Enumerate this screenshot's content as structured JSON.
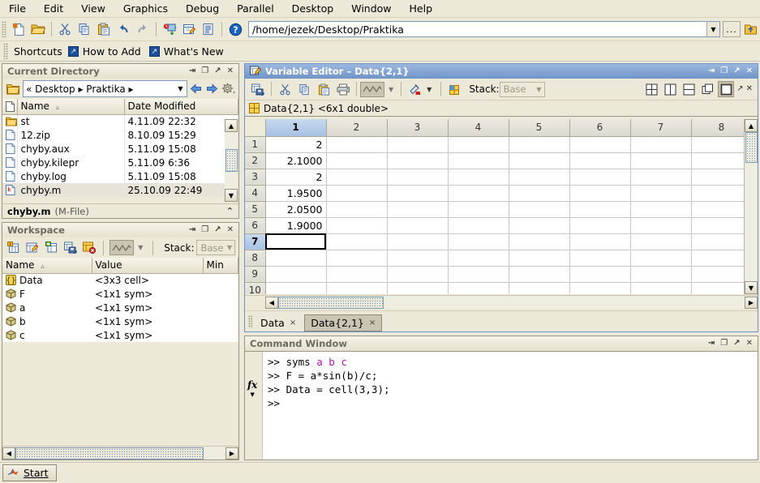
{
  "menubar": {
    "items": [
      {
        "label": "File"
      },
      {
        "label": "Edit"
      },
      {
        "label": "View"
      },
      {
        "label": "Graphics"
      },
      {
        "label": "Debug"
      },
      {
        "label": "Parallel"
      },
      {
        "label": "Desktop"
      },
      {
        "label": "Window"
      },
      {
        "label": "Help"
      }
    ]
  },
  "toolbar": {
    "buttons": [
      {
        "name": "new-file-icon"
      },
      {
        "name": "open-folder-icon"
      },
      {
        "name": "cut-icon"
      },
      {
        "name": "copy-icon"
      },
      {
        "name": "paste-icon"
      },
      {
        "name": "undo-icon"
      },
      {
        "name": "redo-icon"
      },
      {
        "name": "simulink-icon"
      },
      {
        "name": "guide-icon"
      },
      {
        "name": "profiler-icon"
      },
      {
        "name": "help-icon"
      }
    ],
    "path_value": "/home/jezek/Desktop/Praktika",
    "browse_label": "...",
    "up_dir_name": "up-one-level-icon"
  },
  "shortcuts": {
    "label": "Shortcuts",
    "items": [
      {
        "label": "How to Add"
      },
      {
        "label": "What's New"
      }
    ]
  },
  "current_directory": {
    "title": "Current Directory",
    "breadcrumb": "« Desktop ▸ Praktika ▸",
    "columns": [
      "Name",
      "Date Modified"
    ],
    "sort_indicator": "▵",
    "rows": [
      {
        "icon": "folder-icon",
        "name": "st",
        "date": "4.11.09 22:32",
        "selected": false
      },
      {
        "icon": "file-icon",
        "name": "12.zip",
        "date": "8.10.09 15:29",
        "selected": false
      },
      {
        "icon": "file-icon",
        "name": "chyby.aux",
        "date": "5.11.09 15:08",
        "selected": false
      },
      {
        "icon": "file-icon",
        "name": "chyby.kilepr",
        "date": "5.11.09 6:36",
        "selected": false
      },
      {
        "icon": "file-icon",
        "name": "chyby.log",
        "date": "5.11.09 15:08",
        "selected": false
      },
      {
        "icon": "mfile-icon",
        "name": "chyby.m",
        "date": "25.10.09 22:49",
        "selected": true
      }
    ],
    "status_name": "chyby.m",
    "status_type": "(M-File)"
  },
  "workspace": {
    "title": "Workspace",
    "stack_label": "Stack:",
    "stack_value": "Base",
    "columns": [
      "Name",
      "Value",
      "Min"
    ],
    "sort_indicator": "▵",
    "rows": [
      {
        "icon": "cell-icon",
        "name": "Data",
        "value": "<3x3 cell>",
        "min": ""
      },
      {
        "icon": "sym-icon",
        "name": "F",
        "value": "<1x1 sym>",
        "min": ""
      },
      {
        "icon": "sym-icon",
        "name": "a",
        "value": "<1x1 sym>",
        "min": ""
      },
      {
        "icon": "sym-icon",
        "name": "b",
        "value": "<1x1 sym>",
        "min": ""
      },
      {
        "icon": "sym-icon",
        "name": "c",
        "value": "<1x1 sym>",
        "min": ""
      }
    ]
  },
  "variable_editor": {
    "title": "Variable Editor – Data{2,1}",
    "stack_label": "Stack:",
    "stack_value": "Base",
    "info_text": "Data{2,1}  <6x1 double>",
    "columns": [
      "1",
      "2",
      "3",
      "4",
      "5",
      "6",
      "7",
      "8"
    ],
    "selected_column": "1",
    "rows": [
      "1",
      "2",
      "3",
      "4",
      "5",
      "6",
      "7",
      "8",
      "9",
      "10"
    ],
    "active_row": "7",
    "data": [
      [
        "2",
        "",
        "",
        "",
        "",
        "",
        "",
        ""
      ],
      [
        "2.1000",
        "",
        "",
        "",
        "",
        "",
        "",
        ""
      ],
      [
        "2",
        "",
        "",
        "",
        "",
        "",
        "",
        ""
      ],
      [
        "1.9500",
        "",
        "",
        "",
        "",
        "",
        "",
        ""
      ],
      [
        "2.0500",
        "",
        "",
        "",
        "",
        "",
        "",
        ""
      ],
      [
        "1.9000",
        "",
        "",
        "",
        "",
        "",
        "",
        ""
      ],
      [
        "",
        "",
        "",
        "",
        "",
        "",
        "",
        ""
      ],
      [
        "",
        "",
        "",
        "",
        "",
        "",
        "",
        ""
      ],
      [
        "",
        "",
        "",
        "",
        "",
        "",
        "",
        ""
      ],
      [
        "",
        "",
        "",
        "",
        "",
        "",
        "",
        ""
      ]
    ],
    "tabs": [
      {
        "label": "Data",
        "active": false
      },
      {
        "label": "Data{2,1}",
        "active": true
      }
    ],
    "close_glyph": "×"
  },
  "command_window": {
    "title": "Command Window",
    "prompt_icon": "fx",
    "lines": [
      {
        "prompt": ">> ",
        "parts": [
          {
            "text": "syms ",
            "style": "plain"
          },
          {
            "text": "a b c",
            "style": "var"
          }
        ]
      },
      {
        "prompt": ">> ",
        "parts": [
          {
            "text": "F = a*sin(b)/c;",
            "style": "plain"
          }
        ]
      },
      {
        "prompt": ">> ",
        "parts": [
          {
            "text": "Data = cell(3,3);",
            "style": "plain"
          }
        ]
      },
      {
        "prompt": ">> ",
        "parts": [
          {
            "text": "",
            "style": "plain"
          }
        ]
      }
    ]
  },
  "statusbar": {
    "start_label": "Start"
  },
  "window_controls": {
    "undock": "⇥",
    "maximize": "❐",
    "restore": "↗",
    "close": "✕"
  },
  "colors": {
    "desktop_bg": "#ece9d8",
    "active_title": "#6f94c8",
    "selection_blue": "#a7c1e4",
    "symbol_magenta": "#b218b2"
  }
}
